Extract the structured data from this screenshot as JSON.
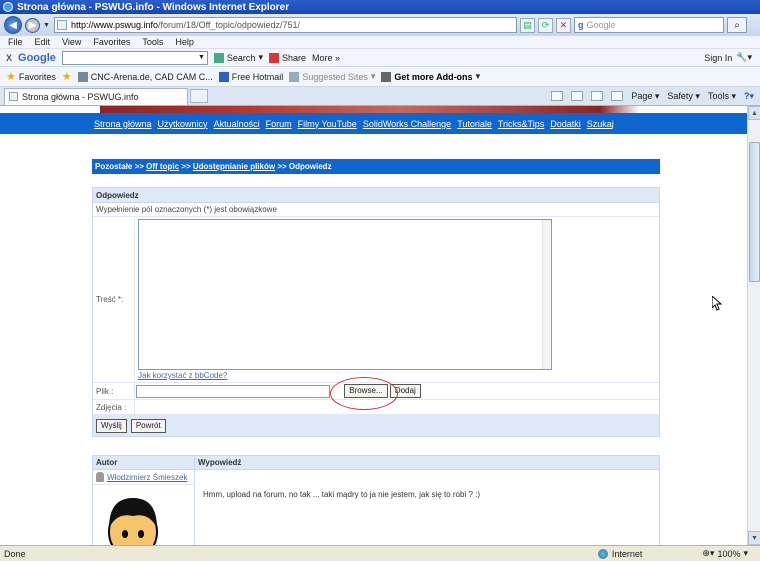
{
  "window": {
    "title": "Strona główna - PSWUG.info - Windows Internet Explorer"
  },
  "address": {
    "url_host": "http://www.pswug.info",
    "url_path": "/forum/18/Off_topic/odpowiedz/751/",
    "search_placeholder": "Google"
  },
  "menu": [
    "File",
    "Edit",
    "View",
    "Favorites",
    "Tools",
    "Help"
  ],
  "google_toolbar": {
    "logo": "Google",
    "close": "X",
    "search_label": "Search",
    "share_label": "Share",
    "more_label": "More »",
    "sign_in_label": "Sign In"
  },
  "favorites_bar": {
    "favorites_label": "Favorites",
    "items": [
      {
        "label": "CNC-Arena.de, CAD CAM C..."
      },
      {
        "label": "Free Hotmail"
      },
      {
        "label": "Suggested Sites"
      },
      {
        "label": "Get more Add-ons"
      }
    ]
  },
  "tab": {
    "title": "Strona główna - PSWUG.info"
  },
  "command_bar": {
    "page_label": "Page",
    "safety_label": "Safety",
    "tools_label": "Tools"
  },
  "site_nav": [
    "Strona główna",
    "Użytkownicy",
    "Aktualności",
    "Forum",
    "Filmy YouTube",
    "SolidWorks Challenge",
    "Tutoriale",
    "Tricks&Tips",
    "Dodatki",
    "Szukaj"
  ],
  "breadcrumb": {
    "root": "Pozostałe",
    "sep": ">>",
    "level1": "Off topic",
    "level2": "Udostępnianie plików",
    "current": "Odpowiedz"
  },
  "reply_form": {
    "heading": "Odpowiedz",
    "required_note": "Wypełnienie pól oznaczonych (*) jest obowiązkowe",
    "content_label": "Treść *:",
    "bbcode_link": "Jak korzystać z bbCode?",
    "file_label": "Plik :",
    "browse_button": "Browse...",
    "add_button": "Dodaj",
    "images_label": "Zdjęcia :",
    "send_button": "Wyślij",
    "back_button": "Powrót"
  },
  "posts": {
    "author_header": "Autor",
    "post_header": "Wypowiedź",
    "items": [
      {
        "author": "Włodzimierz Śmieszek",
        "text": "Hmm, upload na forum, no tak ... taki mądry to ja nie jestem, jak się to robi ? :)"
      }
    ]
  },
  "status_bar": {
    "status": "Done",
    "zone": "Internet",
    "zoom": "100%"
  }
}
